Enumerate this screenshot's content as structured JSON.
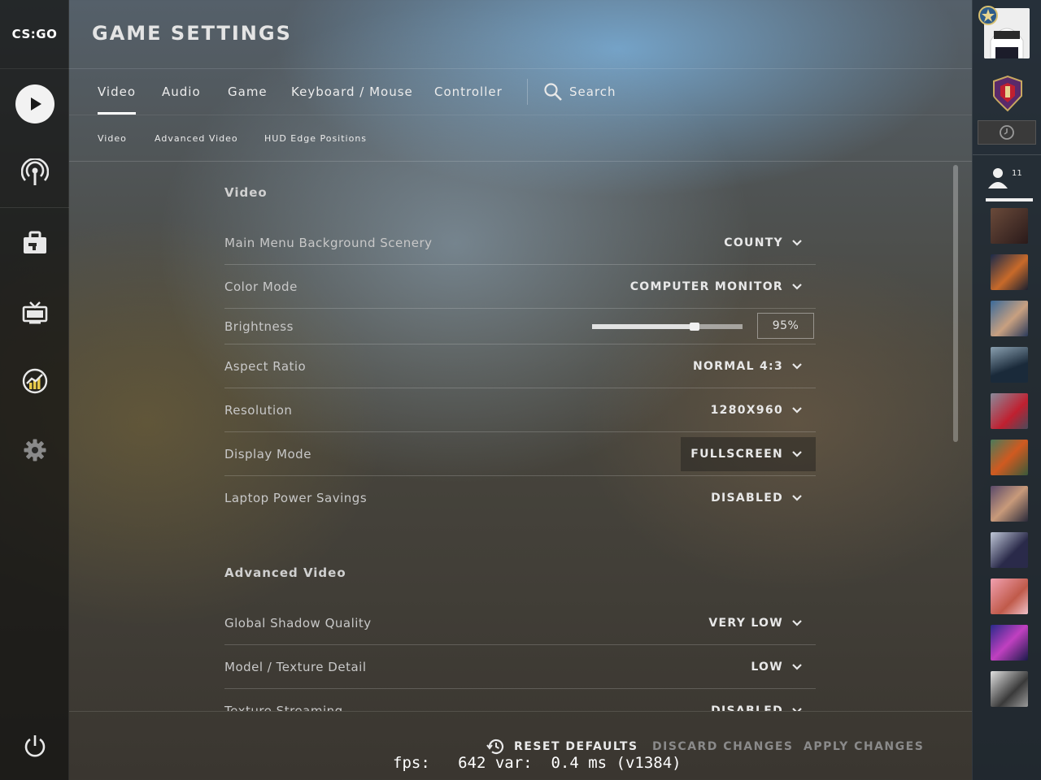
{
  "logo_text": "CS:GO",
  "header": {
    "title": "GAME SETTINGS"
  },
  "tabs": [
    {
      "label": "Video",
      "active": true
    },
    {
      "label": "Audio"
    },
    {
      "label": "Game"
    },
    {
      "label": "Keyboard / Mouse"
    },
    {
      "label": "Controller"
    }
  ],
  "search": {
    "label": "Search"
  },
  "subtabs": [
    "Video",
    "Advanced Video",
    "HUD Edge Positions"
  ],
  "sections": {
    "video": {
      "title": "Video",
      "rows": [
        {
          "label": "Main Menu Background Scenery",
          "value": "COUNTY"
        },
        {
          "label": "Color Mode",
          "value": "COMPUTER MONITOR"
        },
        {
          "label": "Brightness",
          "value": "95%",
          "slider_fraction": 0.68
        },
        {
          "label": "Aspect Ratio",
          "value": "NORMAL 4:3"
        },
        {
          "label": "Resolution",
          "value": "1280X960"
        },
        {
          "label": "Display Mode",
          "value": "FULLSCREEN"
        },
        {
          "label": "Laptop Power Savings",
          "value": "DISABLED"
        }
      ]
    },
    "advanced": {
      "title": "Advanced Video",
      "rows": [
        {
          "label": "Global Shadow Quality",
          "value": "VERY LOW"
        },
        {
          "label": "Model / Texture Detail",
          "value": "LOW"
        },
        {
          "label": "Texture Streaming",
          "value": "DISABLED"
        }
      ]
    }
  },
  "footer": {
    "reset": "RESET DEFAULTS",
    "discard": "DISCARD CHANGES",
    "apply": "APPLY CHANGES"
  },
  "fps_overlay": "fps:   642 var:  0.4 ms (v1384)",
  "friends": {
    "count": "11"
  },
  "colors": {
    "text_primary": "#e8e8e8",
    "text_disabled": "#8a8a8a",
    "sidebar_dark": "#121210",
    "rightbar": "#1c2630"
  },
  "icons": {
    "nav": [
      "play-icon",
      "broadcast-icon",
      "briefcase-icon",
      "tv-icon",
      "stats-icon",
      "gear-icon"
    ],
    "power": "power-icon",
    "search": "search-icon",
    "reset": "history-icon"
  }
}
